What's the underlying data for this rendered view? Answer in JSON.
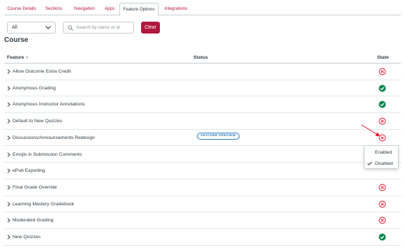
{
  "tabs": [
    {
      "label": "Course Details",
      "active": false
    },
    {
      "label": "Sections",
      "active": false
    },
    {
      "label": "Navigation",
      "active": false
    },
    {
      "label": "Apps",
      "active": false
    },
    {
      "label": "Feature Options",
      "active": true
    },
    {
      "label": "Integrations",
      "active": false
    }
  ],
  "filters": {
    "select_value": "All",
    "search_placeholder": "Search by name or id",
    "clear_label": "Clear"
  },
  "section_title": "Course",
  "table": {
    "col_feature": "Feature",
    "col_status": "Status",
    "col_state": "State",
    "rows": [
      {
        "name": "Allow Outcome Extra Credit",
        "state": "disabled"
      },
      {
        "name": "Anonymous Grading",
        "state": "enabled"
      },
      {
        "name": "Anonymous Instructor Annotations",
        "state": "enabled"
      },
      {
        "name": "Default to New Quizzes",
        "state": "disabled"
      },
      {
        "name": "Discussions/Announcements Redesign",
        "state": "disabled",
        "status": "FEATURE PREVIEW"
      },
      {
        "name": "Emojis in Submission Comments",
        "state": "hidden"
      },
      {
        "name": "ePub Exporting",
        "state": "hidden"
      },
      {
        "name": "Final Grade Override",
        "state": "disabled"
      },
      {
        "name": "Learning Mastery Gradebook",
        "state": "disabled"
      },
      {
        "name": "Moderated Grading",
        "state": "disabled"
      },
      {
        "name": "New Quizzes",
        "state": "enabled"
      }
    ]
  },
  "state_menu": {
    "items": [
      {
        "label": "Enabled",
        "checked": false
      },
      {
        "label": "Disabled",
        "checked": true
      }
    ]
  },
  "colors": {
    "accent": "#b0173d",
    "enabled": "#0b874b",
    "disabled": "#e0061f",
    "preview": "#2b7abc"
  },
  "icons": {
    "enabled": "check-circle-icon",
    "disabled": "x-circle-icon",
    "caret": "chevron-right-icon"
  }
}
